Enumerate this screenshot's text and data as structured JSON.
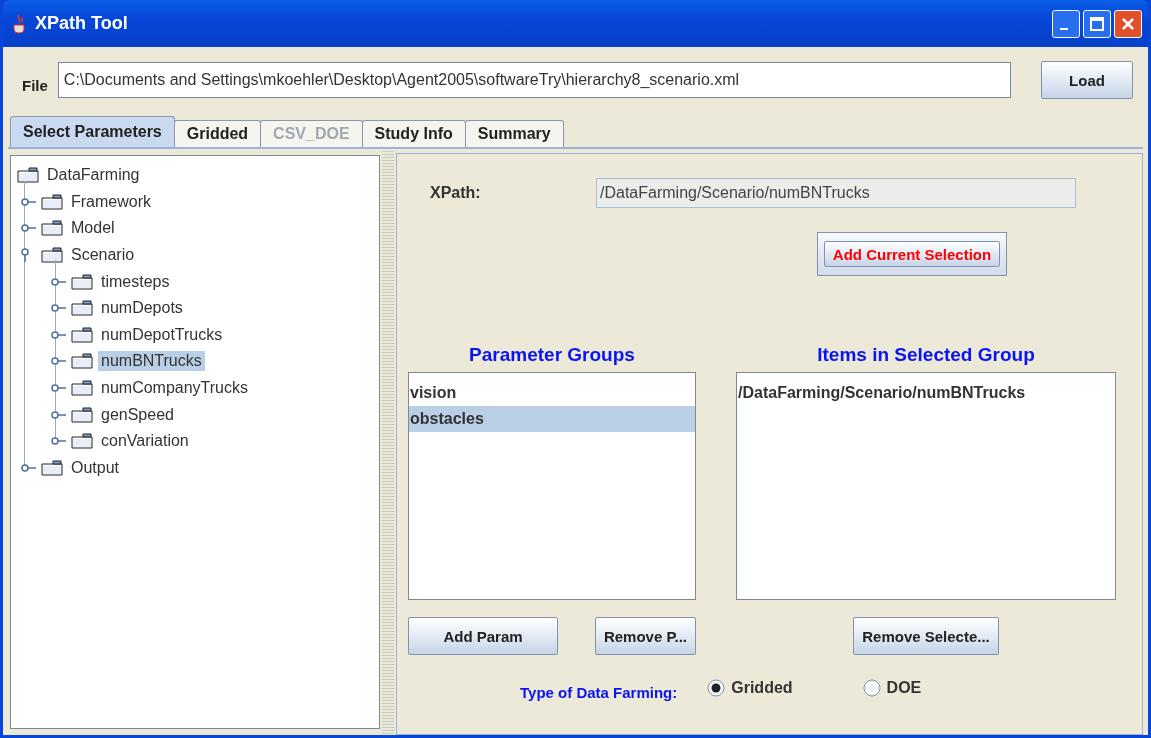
{
  "window": {
    "title": "XPath Tool"
  },
  "file": {
    "label": "File",
    "value": "C:\\Documents and Settings\\mkoehler\\Desktop\\Agent2005\\softwareTry\\hierarchy8_scenario.xml",
    "button": "Load"
  },
  "tabs": [
    {
      "label": "Select Parameters",
      "selected": true,
      "disabled": false
    },
    {
      "label": "Gridded",
      "selected": false,
      "disabled": false
    },
    {
      "label": "CSV_DOE",
      "selected": false,
      "disabled": true
    },
    {
      "label": "Study Info",
      "selected": false,
      "disabled": false
    },
    {
      "label": "Summary",
      "selected": false,
      "disabled": false
    }
  ],
  "tree": [
    {
      "label": "DataFarming",
      "selected": false,
      "children": [
        {
          "label": "Framework",
          "expanded": false,
          "selected": false
        },
        {
          "label": "Model",
          "expanded": false,
          "selected": false
        },
        {
          "label": "Scenario",
          "expanded": true,
          "selected": false,
          "children": [
            {
              "label": "timesteps",
              "expanded": false,
              "selected": false
            },
            {
              "label": "numDepots",
              "expanded": false,
              "selected": false
            },
            {
              "label": "numDepotTrucks",
              "expanded": false,
              "selected": false
            },
            {
              "label": "numBNTrucks",
              "expanded": false,
              "selected": true
            },
            {
              "label": "numCompanyTrucks",
              "expanded": false,
              "selected": false
            },
            {
              "label": "genSpeed",
              "expanded": false,
              "selected": false
            },
            {
              "label": "conVariation",
              "expanded": false,
              "selected": false
            }
          ]
        },
        {
          "label": "Output",
          "expanded": false,
          "selected": false
        }
      ]
    }
  ],
  "xpath": {
    "label": "XPath:",
    "value": "/DataFarming/Scenario/numBNTrucks"
  },
  "add_current_selection": "Add Current Selection",
  "parameter_groups": {
    "title": "Parameter Groups",
    "items": [
      {
        "label": "vision",
        "selected": false
      },
      {
        "label": "obstacles",
        "selected": true
      }
    ],
    "buttons": [
      "Add Param",
      "Remove P..."
    ]
  },
  "selected_group_items": {
    "title": "Items in Selected Group",
    "items": [
      {
        "label": "/DataFarming/Scenario/numBNTrucks",
        "selected": false
      }
    ],
    "button": "Remove Selecte..."
  },
  "type_of_data_farming": {
    "label": "Type of Data Farming:",
    "options": [
      {
        "label": "Gridded",
        "selected": true
      },
      {
        "label": "DOE",
        "selected": false
      }
    ]
  }
}
